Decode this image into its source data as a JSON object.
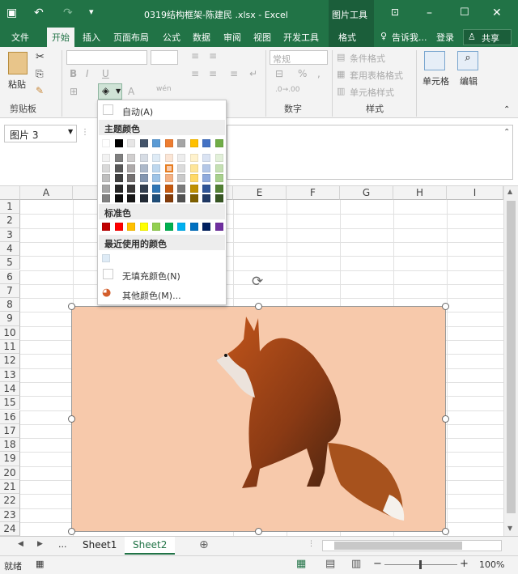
{
  "window": {
    "title": "0319结构框架-陈建民 .xlsx - Excel",
    "context_tool": "图片工具"
  },
  "tabs": [
    "文件",
    "开始",
    "插入",
    "页面布局",
    "公式",
    "数据",
    "审阅",
    "视图",
    "开发工具",
    "格式"
  ],
  "tell_me": "告诉我...",
  "login": "登录",
  "share": "共享",
  "ribbon": {
    "paste": "粘贴",
    "clipboard": "剪贴板",
    "number_format": "常规",
    "number_group": "数字",
    "bold": "B",
    "italic": "I",
    "underline": "U",
    "cond_format": "条件格式",
    "table_format": "套用表格格式",
    "cell_style": "单元格样式",
    "styles_group": "样式",
    "cells": "单元格",
    "edit": "编辑",
    "percent": "%",
    "comma": ","
  },
  "namebox": "图片 3",
  "columns": [
    "A",
    "E",
    "F",
    "G",
    "H",
    "I"
  ],
  "rows": [
    "1",
    "2",
    "3",
    "4",
    "5",
    "6",
    "7",
    "8",
    "9",
    "10",
    "11",
    "12",
    "13",
    "14",
    "15",
    "16",
    "17",
    "18",
    "19",
    "20",
    "21",
    "22",
    "23",
    "24"
  ],
  "sheets": [
    "Sheet1",
    "Sheet2"
  ],
  "sheet_more": "...",
  "status": {
    "ready": "就绪",
    "zoom": "100%"
  },
  "dropdown": {
    "auto": "自动(A)",
    "theme_colors": "主题颜色",
    "standard_colors": "标准色",
    "recent_colors": "最近使用的颜色",
    "no_fill": "无填充颜色(N)",
    "more_colors": "其他颜色(M)...",
    "theme_top": [
      "#ffffff",
      "#000000",
      "#e7e6e6",
      "#44546a",
      "#5b9bd5",
      "#ed7d31",
      "#a5a5a5",
      "#ffc000",
      "#4472c4",
      "#70ad47"
    ],
    "theme_shades": [
      [
        "#f2f2f2",
        "#d9d9d9",
        "#bfbfbf",
        "#a6a6a6",
        "#808080"
      ],
      [
        "#7f7f7f",
        "#595959",
        "#404040",
        "#262626",
        "#0d0d0d"
      ],
      [
        "#d0cece",
        "#aeaaaa",
        "#757171",
        "#3a3838",
        "#171616"
      ],
      [
        "#d6dce4",
        "#adb9ca",
        "#8496b0",
        "#333f4f",
        "#222a35"
      ],
      [
        "#deebf6",
        "#bdd7ee",
        "#9dc3e6",
        "#2e75b5",
        "#1f4e79"
      ],
      [
        "#fbe5d5",
        "#f8cbad",
        "#f4b183",
        "#c55a11",
        "#833c0b"
      ],
      [
        "#ededed",
        "#dbdbdb",
        "#c9c9c9",
        "#7b7b7b",
        "#525252"
      ],
      [
        "#fff2cc",
        "#fee599",
        "#ffd966",
        "#bf9000",
        "#7f6000"
      ],
      [
        "#dae3f3",
        "#b4c7e7",
        "#8faadc",
        "#2f5496",
        "#1f3864"
      ],
      [
        "#e2f0d9",
        "#c5e0b3",
        "#a8d08d",
        "#538135",
        "#375623"
      ]
    ],
    "standard": [
      "#c00000",
      "#ff0000",
      "#ffc000",
      "#ffff00",
      "#92d050",
      "#00b050",
      "#00b0f0",
      "#0070c0",
      "#002060",
      "#7030a0"
    ],
    "recent": [
      "#deebf6"
    ]
  },
  "picture_fill": "#f7c9ab",
  "accent": "#217346"
}
